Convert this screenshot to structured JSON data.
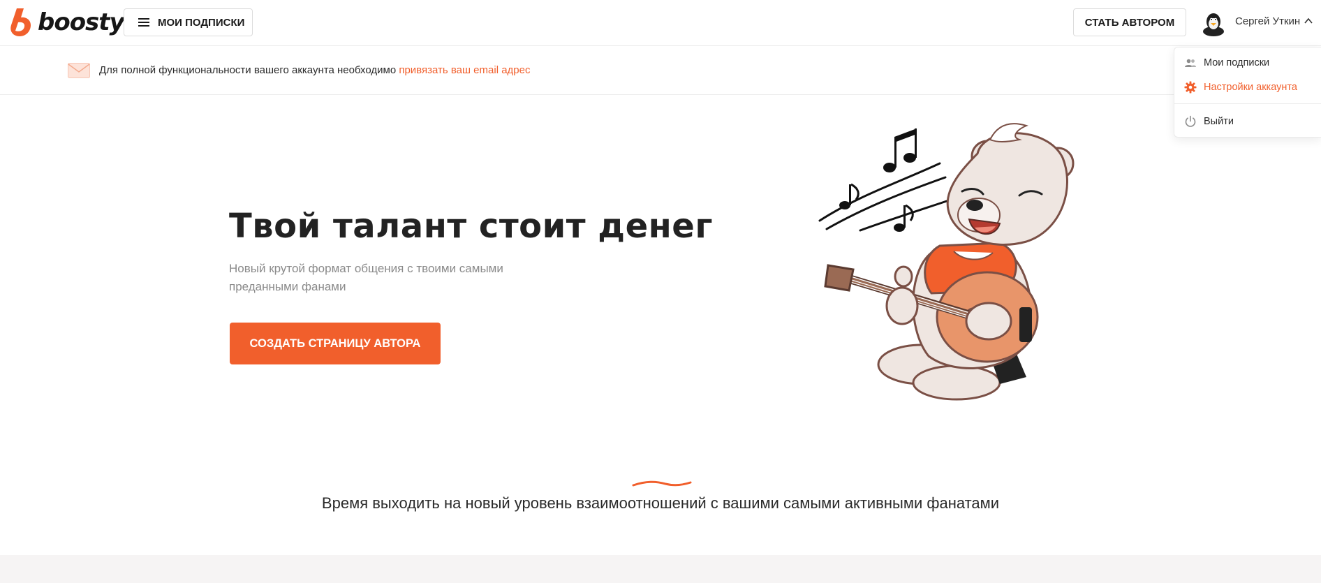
{
  "brand": {
    "name": "boosty",
    "accent": "#f15f2c"
  },
  "header": {
    "subscriptions_label": "МОИ ПОДПИСКИ",
    "become_author_label": "СТАТЬ АВТОРОМ",
    "user_name": "Сергей Уткин"
  },
  "notice": {
    "text": "Для полной функциональности вашего аккаунта необходимо ",
    "link": "привязать ваш email адрес"
  },
  "user_menu": {
    "items": [
      {
        "label": "Мои подписки",
        "icon": "people-icon"
      },
      {
        "label": "Настройки аккаунта",
        "icon": "gear-icon",
        "active": true
      },
      {
        "label": "Выйти",
        "icon": "power-icon"
      }
    ]
  },
  "hero": {
    "title": "Твой талант стоит денег",
    "subtitle": "Новый крутой формат общения с твоими самыми преданными фанами",
    "cta_label": "СОЗДАТЬ СТРАНИЦУ АВТОРА"
  },
  "tagline": "Время выходить на новый уровень взаимоотношений с вашими самыми активными фанатами"
}
